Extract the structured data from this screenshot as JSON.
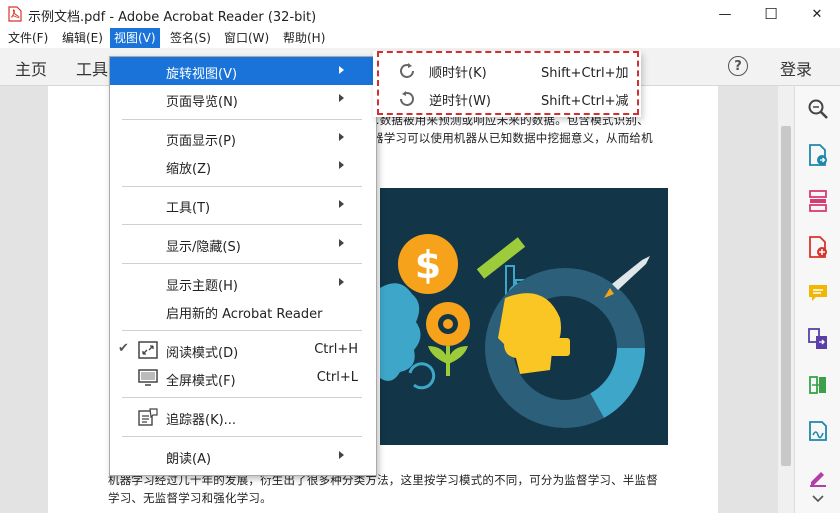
{
  "window": {
    "title": "示例文档.pdf - Adobe Acrobat Reader (32-bit)",
    "minimize_glyph": "—",
    "maximize_glyph": "☐",
    "close_glyph": "✕"
  },
  "menubar": {
    "items": [
      {
        "label": "文件(F)"
      },
      {
        "label": "编辑(E)"
      },
      {
        "label": "视图(V)"
      },
      {
        "label": "签名(S)"
      },
      {
        "label": "窗口(W)"
      },
      {
        "label": "帮助(H)"
      }
    ]
  },
  "toolbar": {
    "home_tab": "主页",
    "tools_tab": "工具",
    "help_glyph": "?",
    "login_label": "登录"
  },
  "document": {
    "line1": "…数据被用来预测或响应未来的数据。包含模式识别、",
    "line2": "器学习可以使用机器从已知数据中挖掘意义，从而给机",
    "line3": "机器学习经过几十年的发展，衍生出了很多种分类方法，这里按学习模式的不同，可分为监督学习、半监督",
    "line4": "学习、无监督学习和强化学习。"
  },
  "view_menu": {
    "items": [
      {
        "label": "旋转视图(V)",
        "submenu": true
      },
      {
        "label": "页面导览(N)",
        "submenu": true
      },
      {
        "label": "页面显示(P)",
        "submenu": true
      },
      {
        "label": "缩放(Z)",
        "submenu": true
      },
      {
        "label": "工具(T)",
        "submenu": true
      },
      {
        "label": "显示/隐藏(S)",
        "submenu": true
      },
      {
        "label": "显示主题(H)",
        "submenu": true
      },
      {
        "label": "启用新的 Acrobat Reader"
      },
      {
        "label": "阅读模式(D)",
        "shortcut": "Ctrl+H",
        "checked": true
      },
      {
        "label": "全屏模式(F)",
        "shortcut": "Ctrl+L"
      },
      {
        "label": "追踪器(K)..."
      },
      {
        "label": "朗读(A)",
        "submenu": true
      }
    ],
    "check_glyph": "✔"
  },
  "rotate_submenu": {
    "items": [
      {
        "label": "顺时针(K)",
        "shortcut": "Shift+Ctrl+加",
        "icon": "rotate-clockwise-icon"
      },
      {
        "label": "逆时针(W)",
        "shortcut": "Shift+Ctrl+减",
        "icon": "rotate-counterclockwise-icon"
      }
    ],
    "highlight_color": "#d32f2f"
  },
  "colors": {
    "accent": "#1a73d9",
    "image_bg": "#123548",
    "pdf_red": "#d9342b"
  }
}
